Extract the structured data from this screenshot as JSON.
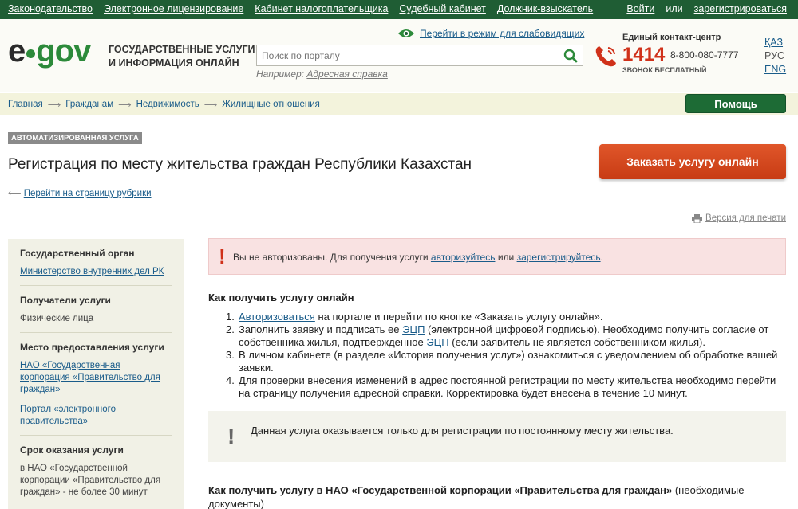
{
  "topbar": {
    "links": [
      "Законодательство",
      "Электронное лицензирование",
      "Кабинет налогоплательщика",
      "Судебный кабинет",
      "Должник-взыскатель"
    ],
    "login": "Войти",
    "or": "или",
    "register": "зарегистрироваться"
  },
  "header": {
    "logo_left": "e",
    "logo_right": "gov",
    "tagline_1": "ГОСУДАРСТВЕННЫЕ УСЛУГИ",
    "tagline_2": "И ИНФОРМАЦИЯ ОНЛАЙН",
    "low_vision": "Перейти в режим для слабовидящих",
    "search_placeholder": "Поиск по порталу",
    "example_label": "Например:",
    "example_link": "Адресная справка",
    "contact_title": "Единый контакт-центр",
    "contact_short": "1414",
    "contact_full": "8-800-080-7777",
    "contact_free": "ЗВОНОК БЕСПЛАТНЫЙ",
    "languages": [
      {
        "code": "ҚАЗ",
        "current": false
      },
      {
        "code": "РУС",
        "current": true
      },
      {
        "code": "ENG",
        "current": false
      }
    ]
  },
  "breadcrumb": {
    "items": [
      "Главная",
      "Гражданам",
      "Недвижимость",
      "Жилищные отношения"
    ],
    "help": "Помощь"
  },
  "service": {
    "badge": "АВТОМАТИЗИРОВАННАЯ УСЛУГА",
    "title": "Регистрация по месту жительства граждан Республики Казахстан",
    "order_button": "Заказать услугу онлайн",
    "back_link": "Перейти на страницу рубрики",
    "print_link": "Версия для печати"
  },
  "sidebar": {
    "org_heading": "Государственный орган",
    "org_link": "Министерство внутренних дел РК",
    "recipients_heading": "Получатели услуги",
    "recipients_text": "Физические лица",
    "place_heading": "Место предоставления услуги",
    "place_link_1": "НАО «Государственная корпорация «Правительство для граждан»",
    "place_link_2": "Портал «электронного правительства»",
    "term_heading": "Срок оказания услуги",
    "term_text": "в НАО «Государственной корпорации «Правительство для граждан» - не более 30 минут"
  },
  "alert": {
    "text_1": "Вы не авторизованы. Для получения услуги ",
    "link_auth": "авторизуйтесь",
    "text_2": " или ",
    "link_reg": "зарегистрируйтесь",
    "text_3": "."
  },
  "online": {
    "heading": "Как получить услугу онлайн",
    "step1_link": "Авторизоваться",
    "step1_text": " на портале и перейти по кнопке «Заказать услугу онлайн».",
    "step2_text_1": "Заполнить заявку и подписать ее ",
    "step2_link_1": "ЭЦП",
    "step2_text_2": " (электронной цифровой подписью). Необходимо получить согласие от собственника жилья, подтвержденное ",
    "step2_link_2": "ЭЦП",
    "step2_text_3": " (если заявитель не является собственником жилья).",
    "step3_text": "В личном кабинете (в разделе «История получения услуг») ознакомиться с уведомлением об обработке вашей заявки.",
    "step4_text": "Для проверки внесения изменений в адрес постоянной регистрации по месту жительства необходимо перейти на страницу получения адресной справки. Корректировка будет внесена в течение 10 минут."
  },
  "info": {
    "text": "Данная услуга оказывается только для регистрации по постоянному месту жительства."
  },
  "nao": {
    "heading_bold": "Как получить услугу в НАО «Государственной корпорации «Правительства для граждан»",
    "heading_rest": " (необходимые документы)"
  },
  "colors": {
    "topbar": "#1f5d34",
    "brand_green": "#2c8a3a",
    "order_button": "#d64a1e",
    "help_button": "#1d6b35",
    "link": "#1a5c8a",
    "alert_bg": "#f9e2e2"
  }
}
